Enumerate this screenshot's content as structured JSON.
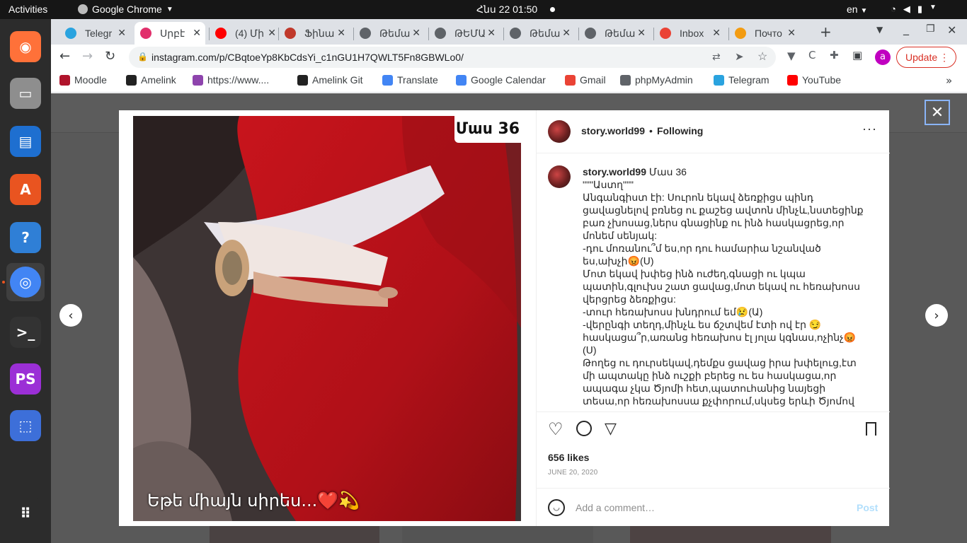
{
  "topbar": {
    "activities": "Activities",
    "app_name": "Google Chrome",
    "clock": "Հնս 22  01:50",
    "lang": "en"
  },
  "dock": {
    "items": [
      {
        "name": "firefox-icon",
        "color": "#ff7139"
      },
      {
        "name": "files-icon",
        "color": "#8e8e8e"
      },
      {
        "name": "writer-icon",
        "color": "#1e6fd0"
      },
      {
        "name": "software-icon",
        "color": "#e95420"
      },
      {
        "name": "help-icon",
        "color": "#2f7fd6"
      },
      {
        "name": "chrome-icon",
        "color": "#4285f4"
      },
      {
        "name": "terminal-icon",
        "color": "#333333"
      },
      {
        "name": "phpstorm-icon",
        "color": "#9b2fd6"
      },
      {
        "name": "screenshot-icon",
        "color": "#3d6fd9"
      },
      {
        "name": "apps-grid-icon",
        "color": "#2c2c2c"
      }
    ]
  },
  "tabs": [
    {
      "label": "Telegr",
      "color": "#2aa3df"
    },
    {
      "label": "Սրբէ",
      "color": "#e1306c"
    },
    {
      "label": "(4) Մի",
      "color": "#ff0000"
    },
    {
      "label": "Ֆինա",
      "color": "#c0392b"
    },
    {
      "label": "Թեմա",
      "color": "#5f6368"
    },
    {
      "label": "ԹԵՄԱ",
      "color": "#5f6368"
    },
    {
      "label": "Թեմա",
      "color": "#5f6368"
    },
    {
      "label": "Թեմա",
      "color": "#5f6368"
    },
    {
      "label": "Inbox",
      "color": "#ea4335"
    },
    {
      "label": "Почто",
      "color": "#f39c12"
    }
  ],
  "toolbar": {
    "url": "instagram.com/p/CBqtoeYp8KbCdsYi_c1nGU1H7QWLT5Fn8GBWLo0/",
    "profile_letter": "a",
    "update_label": "Update"
  },
  "bookmarks": [
    {
      "label": "Moodle",
      "color": "#b0142c"
    },
    {
      "label": "Amelink",
      "color": "#222222"
    },
    {
      "label": "https://www....",
      "color": "#8e44ad"
    },
    {
      "label": "Amelink Git",
      "color": "#222222"
    },
    {
      "label": "Translate",
      "color": "#4285f4"
    },
    {
      "label": "Google Calendar",
      "color": "#4285f4"
    },
    {
      "label": "Gmail",
      "color": "#ea4335"
    },
    {
      "label": "phpMyAdmin",
      "color": "#5f6368"
    },
    {
      "label": "Telegram",
      "color": "#2aa3df"
    },
    {
      "label": "YouTube",
      "color": "#ff0000"
    }
  ],
  "post": {
    "image_top_label": "Մաս 36",
    "image_caption": "Եթե միայն սիրես...❤️💫",
    "username": "story.world99",
    "separator": "•",
    "follow_state": "Following",
    "caption_title": "Մաս 36",
    "caption_body": "\"\"\"Աստղ\"\"\"\nԱնգանգիստ էի: Սուրոն եկավ ձեռքիցս պինդ ցավացնելով բռնեց ու քաշեց ավտոն մինչև,նստեցինք բառ չխոսաց,ներս գնացինք ու ինձ հասկացրեց,որ մոնեմ սենյակ:\n-դու մոռանու՞մ ես,որ դու համարիա նշանված ես,ախչի😡(Ս)\nՄոտ եկավ խփեց ինձ ուժեղ,գնացի ու կպա պատին,գլուխս շատ ցավաց,մոտ եկավ ու հեռախոսս վերցրեց ձեռքիցս:\n-տուր հեռախոսս խնդրում եմ😢(Ա)\n-վերընգի տեղդ,մինչև ես ճշտվեմ էտի ով էր 😏 հասկացա՞ր,առանց հեռախոս էլ յոլա կգնաս,ոչինչ😡(Ս)\nԹողեց ու դուրսեկավ,դեմքս ցավաց իրա խփելուց,էտ մի ապտակը ինձ ուշքի բերեց ու ես հասկացա,որ ապագա չկա Ծյոմի հետ,պատուհանից նայեցի տեսա,որ հեռախոսսա քչփորում,սկսեց երևի Ծյոմով",
    "likes": "656 likes",
    "date": "JUNE 20, 2020",
    "comment_placeholder": "Add a comment…",
    "post_label": "Post"
  }
}
